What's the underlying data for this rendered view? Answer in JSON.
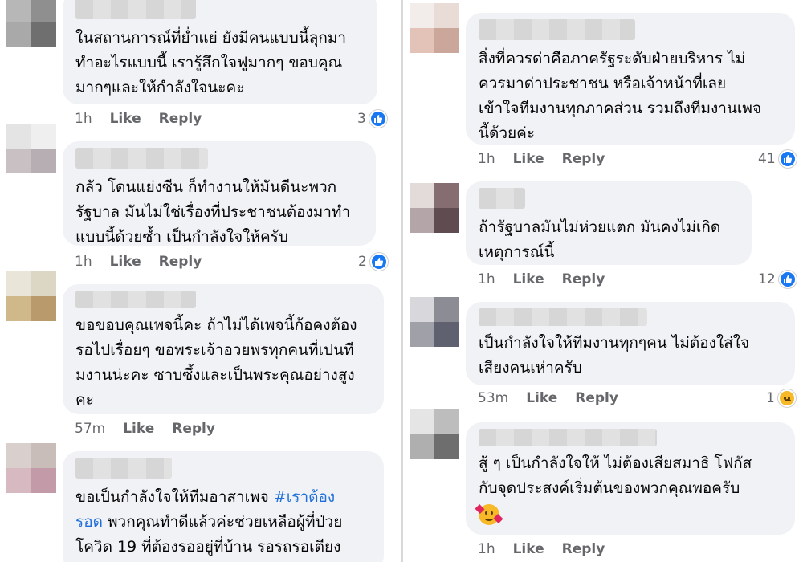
{
  "actions": {
    "like": "Like",
    "reply": "Reply"
  },
  "left_column": [
    {
      "text": "ในสถานการณ์ที่ย่ำแย่ ยังมีคนแบบนี้ลุกมา\nทำอะไรแบบนี้ เรารู้สึกใจฟูมากๆ ขอบคุณ\nมากๆและให้กำลังใจนะคะ",
      "time": "1h",
      "reactions": "3",
      "reaction_icon": "like-icon"
    },
    {
      "text": "กลัว โดนแย่งซีน ก็ทำงานให้มันดีนะพวก\nรัฐบาล มันไม่ใช่เรื่องที่ประชาชนต้องมาทำ\nแบบนี้ด้วยซ้ำ เป็นกำลังใจให้ครับ",
      "time": "1h",
      "reactions": "2",
      "reaction_icon": "like-icon"
    },
    {
      "text": "ขอขอบคุณเพจนี้คะ ถ้าไม่ได้เพจนี้ก้อคงต้อง\nรอไปเรื่อยๆ ขอพระเจ้าอวยพรทุกคนที่เปนที\nมงานน่ะคะ ซาบซึ้งและเป็นพระคุณอย่างสูง\nคะ",
      "time": "57m",
      "reactions": "",
      "reaction_icon": ""
    },
    {
      "text_before": "ขอเป็นกำลังใจให้ทีมอาสาเพจ ",
      "hashtag": "#เราต้อง\nรอด",
      "text_after": " พวกคุณทำดีแล้วค่ะช่วยเหลือผู้ที่ป่วย\nโควิด 19 ที่ต้องรออยู่ที่บ้าน รอรถรอเตียง",
      "time": "",
      "reactions": "",
      "reaction_icon": ""
    }
  ],
  "right_column": [
    {
      "text": "สิ่งที่ควรด่าคือภาครัฐระดับฝ่ายบริหาร ไม่\nควรมาด่าประชาชน หรือเจ้าหน้าที่เลย\nเข้าใจทีมงานทุกภาคส่วน รวมถึงทีมงานเพจ\nนี้ด้วยค่ะ",
      "time": "1h",
      "reactions": "41",
      "reaction_icon": "like-icon"
    },
    {
      "text": "ถ้ารัฐบาลมันไม่ห่วยแตก มันคงไม่เกิด\nเหตุการณ์นี้",
      "time": "1h",
      "reactions": "12",
      "reaction_icon": "like-icon"
    },
    {
      "text": "เป็นกำลังใจให้ทีมงานทุกๆคน ไม่ต้องใส่ใจ\nเสียงคนเห่าครับ",
      "time": "53m",
      "reactions": "1",
      "reaction_icon": "sad-icon"
    },
    {
      "text": "สู้ ๆ เป็นกำลังใจให้ ไม่ต้องเสียสมาธิ โฟกัส\nกับจุดประสงค์เริ่มต้นของพวกคุณพอครับ",
      "emoji": "smiling-face-with-hearts-icon",
      "time": "1h",
      "reactions": "",
      "reaction_icon": ""
    }
  ],
  "avatar_colors": {
    "l0": [
      "#b7b7b7",
      "#8f8f8f",
      "#a9a9a9",
      "#6f6f6f"
    ],
    "l1": [
      "#e4e4e4",
      "#efefef",
      "#c9c0c4",
      "#b6aeb2"
    ],
    "l2": [
      "#e9e6d9",
      "#dcd6c4",
      "#cfb98a",
      "#b89a6c"
    ],
    "l3": [
      "#d9d0cd",
      "#c9bdb9",
      "#d7b9c2",
      "#c39aa8"
    ],
    "r0": [
      "#f2ecea",
      "#e9dcd7",
      "#e3c2b8",
      "#caa69b"
    ],
    "r1": [
      "#e3dada",
      "#866d72",
      "#b4a6a8",
      "#5f4b50"
    ],
    "r2": [
      "#d7d7dc",
      "#8b8c94",
      "#9fa0a8",
      "#5f6170"
    ],
    "r3": [
      "#e5e5e5",
      "#bdbdbd",
      "#b0afaf",
      "#6e6e6e"
    ]
  }
}
